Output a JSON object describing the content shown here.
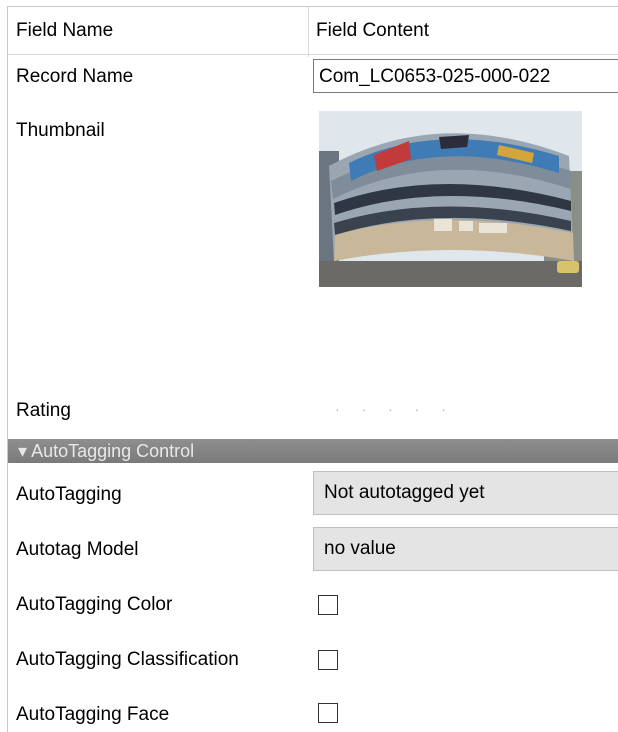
{
  "header": {
    "field_name": "Field Name",
    "field_content": "Field Content"
  },
  "fields": {
    "record_name": {
      "label": "Record Name",
      "value": "Com_LC0653-025-000-022"
    },
    "thumbnail": {
      "label": "Thumbnail"
    },
    "rating": {
      "label": "Rating",
      "dots": "· · · · ·"
    }
  },
  "section": {
    "title": "AutoTagging Control",
    "arrow": "▾"
  },
  "autotagging": {
    "label": "AutoTagging",
    "value": "Not autotagged yet"
  },
  "autotag_model": {
    "label": "Autotag Model",
    "value": "no value"
  },
  "checks": {
    "color": {
      "label": "AutoTagging Color",
      "checked": false
    },
    "classification": {
      "label": "AutoTagging Classification",
      "checked": false
    },
    "face": {
      "label": "AutoTagging Face",
      "checked": false
    }
  }
}
